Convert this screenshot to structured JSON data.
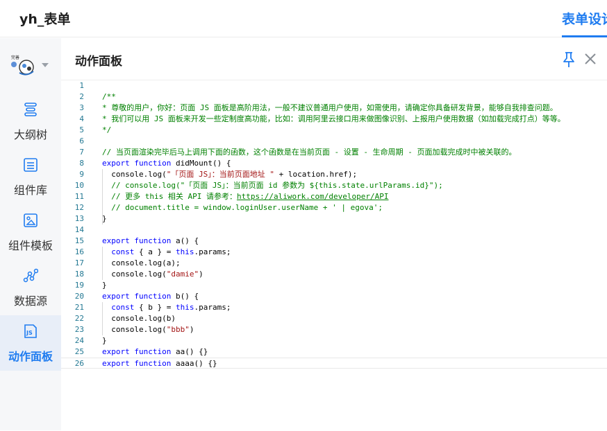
{
  "app": {
    "title": "yh_表单",
    "active_tab": "表单设计"
  },
  "sidebar": {
    "avatar": {
      "icon": "user-avatar-icon",
      "caret": "chevron-down-icon"
    },
    "items": [
      {
        "label": "大纲树",
        "icon": "outline-tree-icon",
        "active": false
      },
      {
        "label": "组件库",
        "icon": "component-library-icon",
        "active": false
      },
      {
        "label": "组件模板",
        "icon": "component-template-icon",
        "active": false
      },
      {
        "label": "数据源",
        "icon": "data-source-icon",
        "active": false
      },
      {
        "label": "动作面板",
        "icon": "js-file-icon",
        "active": true
      }
    ]
  },
  "panel": {
    "title": "动作面板",
    "pin_icon": "pin-icon",
    "close_icon": "close-icon"
  },
  "editor": {
    "current_line": 26,
    "lines": [
      {
        "n": "1",
        "segs": []
      },
      {
        "n": "2",
        "segs": [
          {
            "t": "/**",
            "c": "cm"
          }
        ]
      },
      {
        "n": "3",
        "segs": [
          {
            "t": "* 尊敬的用户，你好：页面 JS 面板是高阶用法，一般不建议普通用户使用，如需使用，请确定你具备研发背景，能够自我排查问题。",
            "c": "cm"
          }
        ]
      },
      {
        "n": "4",
        "segs": [
          {
            "t": "* 我们可以用 JS 面板来开发一些定制度高功能，比如：调用阿里云接口用来做图像识别、上报用户使用数据（如加载完成打点）等等。",
            "c": "cm"
          }
        ]
      },
      {
        "n": "5",
        "segs": [
          {
            "t": "*/",
            "c": "cm"
          }
        ]
      },
      {
        "n": "6",
        "segs": []
      },
      {
        "n": "7",
        "segs": [
          {
            "t": "// 当页面渲染完毕后马上调用下面的函数，这个函数是在当前页面 - 设置 - 生命周期 - 页面加载完成时中被关联的。",
            "c": "cm"
          }
        ]
      },
      {
        "n": "8",
        "segs": [
          {
            "t": "export ",
            "c": "kw"
          },
          {
            "t": "function ",
            "c": "kw"
          },
          {
            "t": "didMount() {",
            "c": ""
          }
        ]
      },
      {
        "n": "9",
        "segs": [
          {
            "t": "  console.log(",
            "c": ""
          },
          {
            "t": "\"「页面 JS」：当前页面地址 \"",
            "c": "st"
          },
          {
            "t": " + location.href);",
            "c": ""
          }
        ]
      },
      {
        "n": "10",
        "segs": [
          {
            "t": "  // console.log(\"「页面 JS」：当前页面 id 参数为 ${this.state.urlParams.id}\");",
            "c": "cm"
          }
        ]
      },
      {
        "n": "11",
        "segs": [
          {
            "t": "  // 更多 this 相关 API 请参考：",
            "c": "cm"
          },
          {
            "t": "https://aliwork.com/developer/API",
            "c": "cm ul"
          }
        ]
      },
      {
        "n": "12",
        "segs": [
          {
            "t": "  // document.title = window.loginUser.userName + ' | egova';",
            "c": "cm"
          }
        ]
      },
      {
        "n": "13",
        "segs": [
          {
            "t": "}",
            "c": ""
          }
        ]
      },
      {
        "n": "14",
        "segs": []
      },
      {
        "n": "15",
        "segs": [
          {
            "t": "export ",
            "c": "kw"
          },
          {
            "t": "function ",
            "c": "kw"
          },
          {
            "t": "a() {",
            "c": ""
          }
        ]
      },
      {
        "n": "16",
        "segs": [
          {
            "t": "  ",
            "c": ""
          },
          {
            "t": "const ",
            "c": "kw"
          },
          {
            "t": "{ a } = ",
            "c": ""
          },
          {
            "t": "this",
            "c": "kw"
          },
          {
            "t": ".params;",
            "c": ""
          }
        ]
      },
      {
        "n": "17",
        "segs": [
          {
            "t": "  console.log(a);",
            "c": ""
          }
        ]
      },
      {
        "n": "18",
        "segs": [
          {
            "t": "  console.log(",
            "c": ""
          },
          {
            "t": "\"damie\"",
            "c": "st"
          },
          {
            "t": ")",
            "c": ""
          }
        ]
      },
      {
        "n": "19",
        "segs": [
          {
            "t": "}",
            "c": ""
          }
        ]
      },
      {
        "n": "20",
        "segs": [
          {
            "t": "export ",
            "c": "kw"
          },
          {
            "t": "function ",
            "c": "kw"
          },
          {
            "t": "b() {",
            "c": ""
          }
        ]
      },
      {
        "n": "21",
        "segs": [
          {
            "t": "  ",
            "c": ""
          },
          {
            "t": "const ",
            "c": "kw"
          },
          {
            "t": "{ b } = ",
            "c": ""
          },
          {
            "t": "this",
            "c": "kw"
          },
          {
            "t": ".params;",
            "c": ""
          }
        ]
      },
      {
        "n": "22",
        "segs": [
          {
            "t": "  console.log(b)",
            "c": ""
          }
        ]
      },
      {
        "n": "23",
        "segs": [
          {
            "t": "  console.log(",
            "c": ""
          },
          {
            "t": "\"bbb\"",
            "c": "st"
          },
          {
            "t": ")",
            "c": ""
          }
        ]
      },
      {
        "n": "24",
        "segs": [
          {
            "t": "}",
            "c": ""
          }
        ]
      },
      {
        "n": "25",
        "segs": [
          {
            "t": "export ",
            "c": "kw"
          },
          {
            "t": "function ",
            "c": "kw"
          },
          {
            "t": "aa() {}",
            "c": ""
          }
        ]
      },
      {
        "n": "26",
        "segs": [
          {
            "t": "export ",
            "c": "kw"
          },
          {
            "t": "function ",
            "c": "kw"
          },
          {
            "t": "aaaa() {}",
            "c": ""
          }
        ]
      }
    ]
  }
}
